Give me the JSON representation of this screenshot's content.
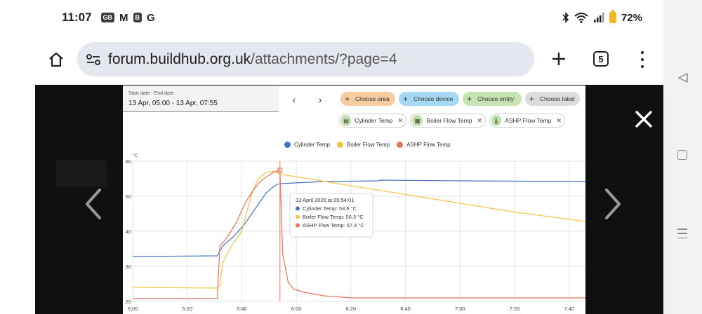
{
  "status_bar": {
    "time": "11:07",
    "badges": [
      "GB",
      "M",
      "B",
      "G"
    ],
    "battery": "72%"
  },
  "browser": {
    "url_host": "forum.buildhub.org.uk",
    "url_path": "/attachments/?page=4",
    "tab_count": "5",
    "icons": [
      "home-icon",
      "site-settings-icon",
      "plus-icon",
      "tab-switcher-icon",
      "overflow-menu-icon"
    ]
  },
  "lightbox": {
    "icons": [
      "chevron-left-icon",
      "chevron-right-icon",
      "close-icon"
    ]
  },
  "graph_header": {
    "date_label": "Start date - End date",
    "date_value": "13 Apr, 05:00 - 13 Apr, 07:55",
    "prev": "‹",
    "next": "›",
    "chips": {
      "area": "Choose area",
      "device": "Choose device",
      "entity": "Choose entity",
      "label": "Choose label"
    },
    "tags": {
      "cylinder": "Cylinder Temp",
      "boiler": "Boiler Flow Temp",
      "ashp": "ASHP Flow Temp"
    }
  },
  "chart_data": {
    "type": "line",
    "ylabel": "°C",
    "ylim": [
      20,
      60
    ],
    "yticks": [
      "20",
      "30",
      "40",
      "50",
      "60"
    ],
    "xlim": [
      "05:00",
      "07:46"
    ],
    "xticks": [
      "5:00",
      "5:20",
      "5:40",
      "6:00",
      "6:20",
      "6:40",
      "7:00",
      "7:20",
      "7:40"
    ],
    "grid": true,
    "legend": "top-center",
    "series": [
      {
        "name": "Cylinder Temp",
        "color": "#4472c4",
        "points": [
          [
            "05:00",
            32.8
          ],
          [
            "05:31",
            33.0
          ],
          [
            "05:33",
            35.8
          ],
          [
            "05:37",
            38.5
          ],
          [
            "05:41",
            42.0
          ],
          [
            "05:45",
            46.5
          ],
          [
            "05:49",
            51.0
          ],
          [
            "05:52",
            53.0
          ],
          [
            "05:54",
            53.6
          ],
          [
            "06:10",
            54.2
          ],
          [
            "06:30",
            54.4
          ],
          [
            "06:31",
            54.6
          ],
          [
            "07:00",
            54.4
          ],
          [
            "07:46",
            54.2
          ]
        ]
      },
      {
        "name": "Boiler Flow Temp",
        "color": "#f4c542",
        "points": [
          [
            "05:00",
            24.0
          ],
          [
            "05:31",
            23.8
          ],
          [
            "05:32",
            24.5
          ],
          [
            "05:33",
            31.0
          ],
          [
            "05:36",
            35.5
          ],
          [
            "05:40",
            40.0
          ],
          [
            "05:42",
            46.0
          ],
          [
            "05:44",
            51.5
          ],
          [
            "05:46",
            55.0
          ],
          [
            "05:49",
            56.8
          ],
          [
            "05:52",
            57.2
          ],
          [
            "05:54",
            56.3
          ],
          [
            "06:20",
            53.0
          ],
          [
            "06:40",
            50.5
          ],
          [
            "07:00",
            48.0
          ],
          [
            "07:20",
            45.5
          ],
          [
            "07:46",
            42.8
          ]
        ]
      },
      {
        "name": "ASHP Flow Temp",
        "color": "#e8735f",
        "points": [
          [
            "05:00",
            20.8
          ],
          [
            "05:31",
            20.8
          ],
          [
            "05:32",
            36.0
          ],
          [
            "05:34",
            37.5
          ],
          [
            "05:36",
            40.0
          ],
          [
            "05:38",
            42.5
          ],
          [
            "05:40",
            46.0
          ],
          [
            "05:42",
            49.0
          ],
          [
            "05:44",
            51.5
          ],
          [
            "05:46",
            53.5
          ],
          [
            "05:48",
            55.0
          ],
          [
            "05:50",
            56.0
          ],
          [
            "05:52",
            57.0
          ],
          [
            "05:54",
            57.4
          ],
          [
            "05:55",
            33.5
          ],
          [
            "05:56",
            29.5
          ],
          [
            "05:57",
            25.5
          ],
          [
            "05:59",
            23.5
          ],
          [
            "06:03",
            22.6
          ],
          [
            "06:10",
            21.6
          ],
          [
            "06:20",
            21.0
          ],
          [
            "06:40",
            21.0
          ],
          [
            "07:00",
            21.0
          ],
          [
            "07:46",
            21.0
          ]
        ]
      }
    ],
    "tooltip": {
      "title": "13 April 2025 at 05:54:01",
      "rows": [
        "Cylinder Temp: 53.6 °C",
        "Boiler Flow Temp: 56.3 °C",
        "ASHP Flow Temp: 57.4 °C"
      ]
    }
  }
}
